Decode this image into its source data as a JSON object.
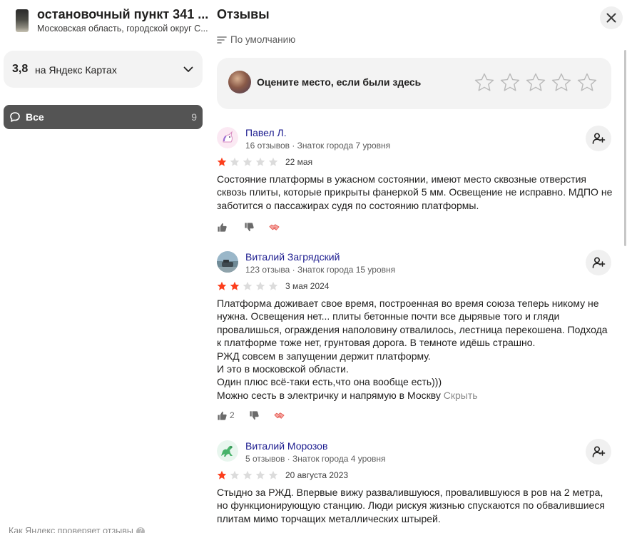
{
  "place": {
    "title": "остановочный пункт 341 ...",
    "subtitle": "Московская область, городской округ С...",
    "rating_value": "3,8",
    "rating_label": "на Яндекс Картах"
  },
  "filter": {
    "label": "Все",
    "count": "9"
  },
  "footer": {
    "link": "Как Яндекс проверяет отзывы",
    "help_glyph": "?"
  },
  "panel": {
    "title": "Отзывы",
    "sort_label": "По умолчанию",
    "rate_prompt": "Оцените место, если были здесь"
  },
  "colors": {
    "star_filled": "#fc3f1d",
    "star_empty": "#dcdcdc",
    "author": "#1c1c8f",
    "accent_bg": "#f3f3f3"
  },
  "icons": {
    "close": "close-icon",
    "sort": "sort-lines-icon",
    "subscribe": "add-user-icon",
    "like": "thumb-up-icon",
    "dislike": "thumb-down-icon",
    "share": "handshake-icon"
  },
  "reviews": [
    {
      "author": "Павел Л.",
      "meta": "16 отзывов · Знаток города 7 уровня",
      "rating": 1,
      "date": "22 мая",
      "text": "Состояние платформы в ужасном состоянии, имеют место сквозные отверстия сквозь плиты, которые прикрыты фанеркой 5 мм. Освещение не исправно. МДПО не заботится о пассажирах судя по состоянию платформы.",
      "hide_label": "",
      "likes": ""
    },
    {
      "author": "Виталий Загрядский",
      "meta": "123 отзыва · Знаток города 15 уровня",
      "rating": 2,
      "date": "3 мая 2024",
      "text": "Платформа доживает свое время, построенная во время союза теперь никому не нужна. Освещения нет... плиты бетонные почти все дырявые того и гляди провалишься, ограждения наполовину отвалилось, лестница перекошена. Подхода к платформе тоже нет, грунтовая дорога. В темноте идёшь страшно.\nРЖД совсем в запущении держит платформу.\nИ это в московской области.\nОдин плюс всё-таки есть,что она вообще есть)))\nМожно сесть в электричку и напрямую в Москву ",
      "hide_label": "Скрыть",
      "likes": "2"
    },
    {
      "author": "Виталий Морозов",
      "meta": "5 отзывов · Знаток города 4 уровня",
      "rating": 1,
      "date": "20 августа 2023",
      "text": "Стыдно за РЖД. Впервые вижу развалившуюся, провалившуюся в ров на 2 метра, но функционирующую станцию. Люди рискуя жизнью спускаются по обвалившиеся плитам мимо торчащих металлических штырей.",
      "hide_label": "",
      "likes": ""
    }
  ]
}
